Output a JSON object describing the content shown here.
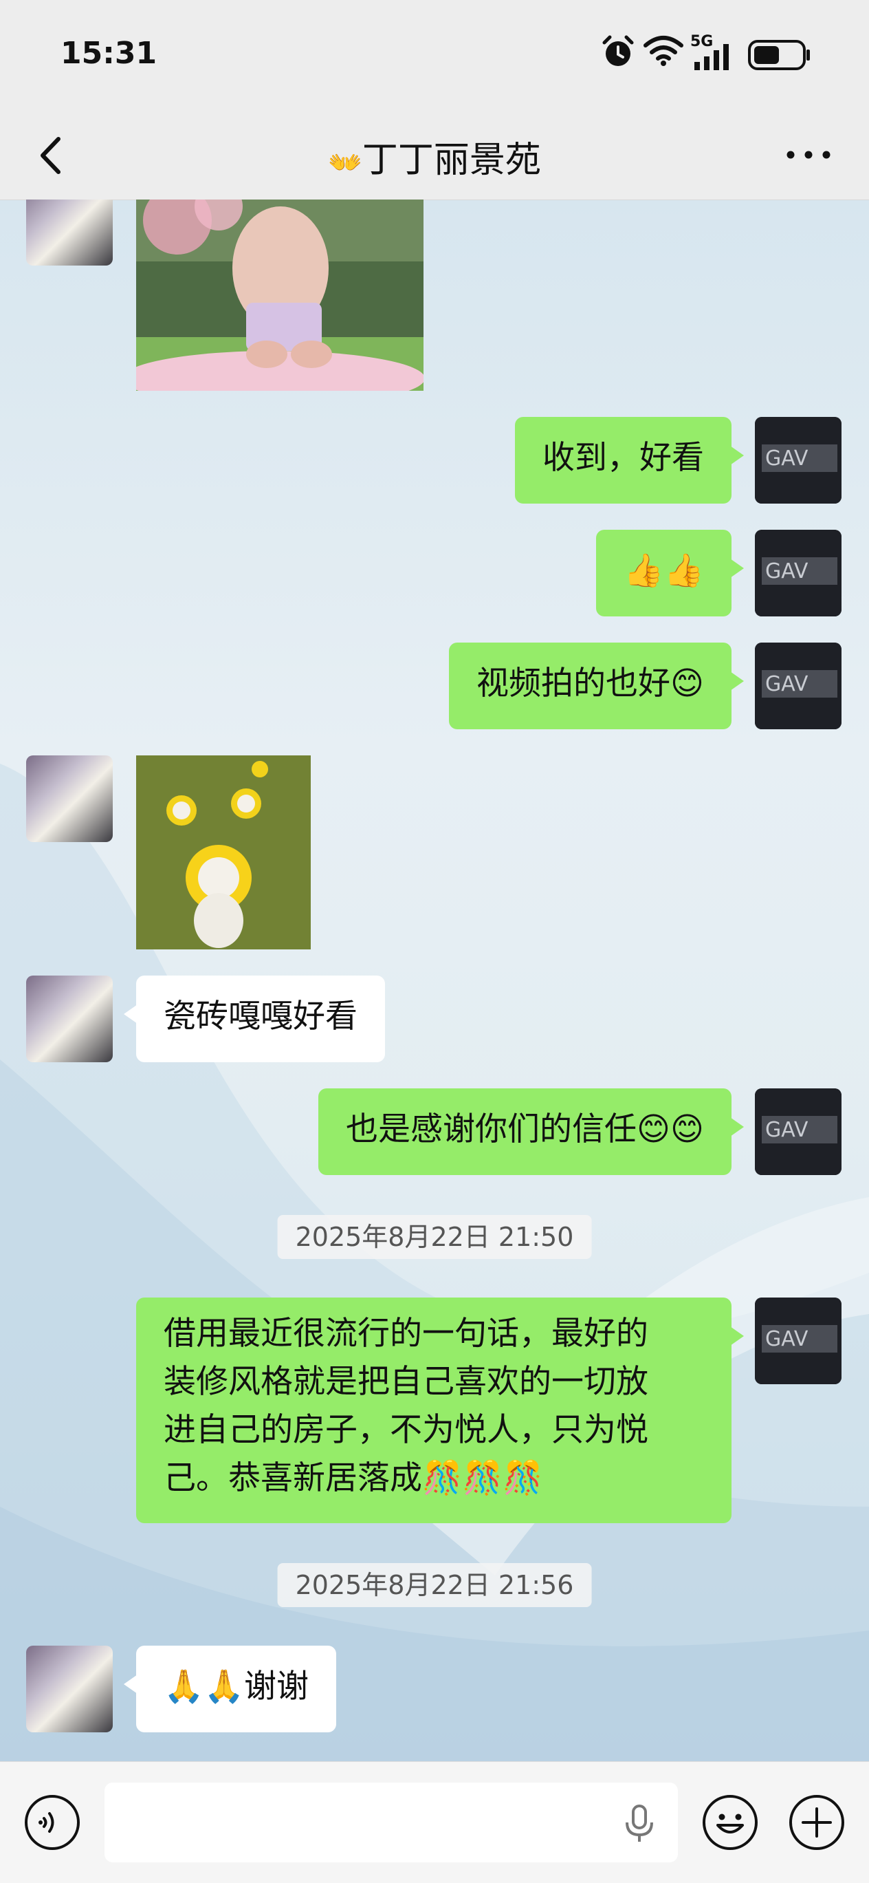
{
  "status_bar": {
    "time": "15:31",
    "network": "5G",
    "icons": [
      "alarm-icon",
      "wifi-icon",
      "5g-signal-icon",
      "battery-icon"
    ]
  },
  "header": {
    "title_emoji": "👐",
    "title": "丁丁丽景苑",
    "back_icon": "chevron-left-icon",
    "more_icon": "more-dots-icon"
  },
  "messages": [
    {
      "sender": "other",
      "type": "image",
      "image": "cartoon-bear-image"
    },
    {
      "sender": "self",
      "type": "text",
      "text": "收到，好看"
    },
    {
      "sender": "self",
      "type": "text",
      "text": "👍👍"
    },
    {
      "sender": "self",
      "type": "text",
      "text": "视频拍的也好😊"
    },
    {
      "sender": "other",
      "type": "image",
      "image": "sunflower-dogs-image"
    },
    {
      "sender": "other",
      "type": "text",
      "text": "瓷砖嘎嘎好看"
    },
    {
      "sender": "self",
      "type": "text",
      "text": "也是感谢你们的信任😊😊"
    },
    {
      "type": "timestamp",
      "text": "2025年8月22日 21:50"
    },
    {
      "sender": "self",
      "type": "text",
      "lines": [
        "借用最近很流行的一句话，最好的",
        "装修风格就是把自己喜欢的一切放",
        "进自己的房子，不为悦人，只为悦",
        "己。恭喜新居落成🎊🎊🎊"
      ]
    },
    {
      "type": "timestamp",
      "text": "2025年8月22日 21:56"
    },
    {
      "sender": "other",
      "type": "text",
      "text": "🙏🙏谢谢"
    }
  ],
  "input_bar": {
    "voice_toggle_icon": "voice-toggle-icon",
    "mic_icon": "microphone-icon",
    "emoji_icon": "emoji-icon",
    "plus_icon": "plus-icon",
    "value": ""
  },
  "colors": {
    "self_bubble": "#95ec69",
    "other_bubble": "#ffffff",
    "bar_bg": "#ededed"
  }
}
